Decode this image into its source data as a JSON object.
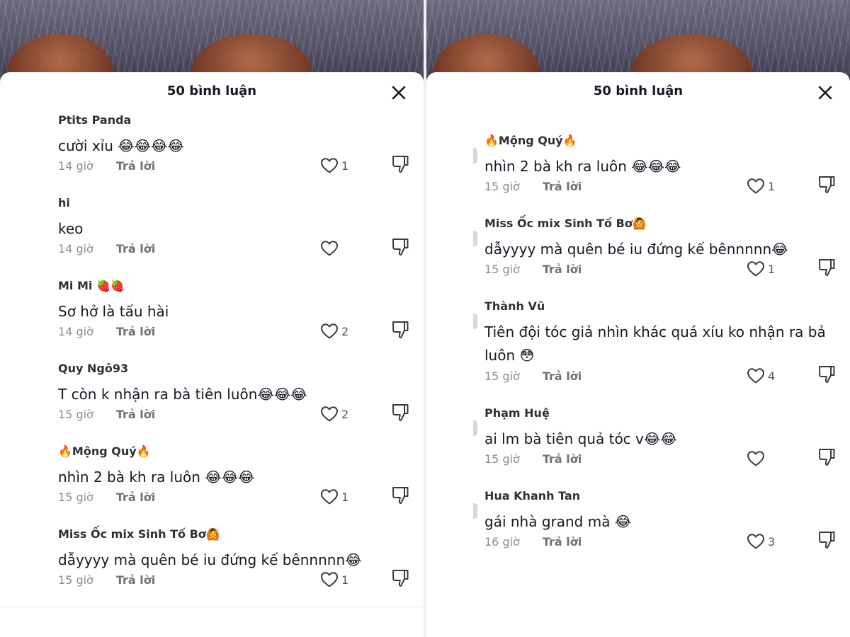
{
  "title": "50 bình luận",
  "left_panel": {
    "comments": [
      {
        "author": "Ptits Panda",
        "text": "cười xỉu 😂😂😂😂",
        "time": "14 giờ",
        "reply": "Trả lời",
        "likes": "1"
      },
      {
        "author": "hi",
        "text": "keo",
        "time": "14 giờ",
        "reply": "Trả lời",
        "likes": ""
      },
      {
        "author": "Mi Mi 🍓🍓",
        "text": "Sơ hở là tấu hài",
        "time": "14 giờ",
        "reply": "Trả lời",
        "likes": "2"
      },
      {
        "author": "Quy Ngô93",
        "text": "T còn k nhận ra bà tiên luôn😂😂😂",
        "time": "15 giờ",
        "reply": "Trả lời",
        "likes": "2"
      },
      {
        "author": "🔥Mộng Quý🔥",
        "text": "nhìn 2 bà kh ra luôn 😂😂😂",
        "time": "15 giờ",
        "reply": "Trả lời",
        "likes": "1"
      },
      {
        "author": "Miss Ốc mix Sinh Tố Bơ🙆",
        "text": "dẫyyyy mà quên bé iu đứng kế bênnnnn😂",
        "time": "15 giờ",
        "reply": "Trả lời",
        "likes": "1"
      }
    ]
  },
  "right_panel": {
    "comments": [
      {
        "author": "🔥Mộng Quý🔥",
        "text": "nhìn 2 bà kh ra luôn 😂😂😂",
        "time": "15 giờ",
        "reply": "Trả lời",
        "likes": "1"
      },
      {
        "author": "Miss Ốc mix Sinh Tố Bơ🙆",
        "text": "dẫyyyy mà quên bé iu đứng kế bênnnnn😂",
        "time": "15 giờ",
        "reply": "Trả lời",
        "likes": "1"
      },
      {
        "author": "Thành Vũ",
        "text": "Tiên đội tóc giả nhìn khác quá xíu ko nhận ra bả luôn 😳",
        "time": "15 giờ",
        "reply": "Trả lời",
        "likes": "4"
      },
      {
        "author": "Phạm Huệ",
        "text": "ai lm bà tiên quả tóc v😂😂",
        "time": "15 giờ",
        "reply": "Trả lời",
        "likes": ""
      },
      {
        "author": "Hua Khanh Tan",
        "text": "gái nhà grand mà 😂",
        "time": "16 giờ",
        "reply": "Trả lời",
        "likes": "3"
      }
    ]
  },
  "icons": {
    "close": "close-icon",
    "like": "heart-outline-icon",
    "dislike": "thumbs-down-icon"
  },
  "colors": {
    "text": "#161823",
    "muted": "#8a8b91",
    "accent": "#fe2c55"
  }
}
